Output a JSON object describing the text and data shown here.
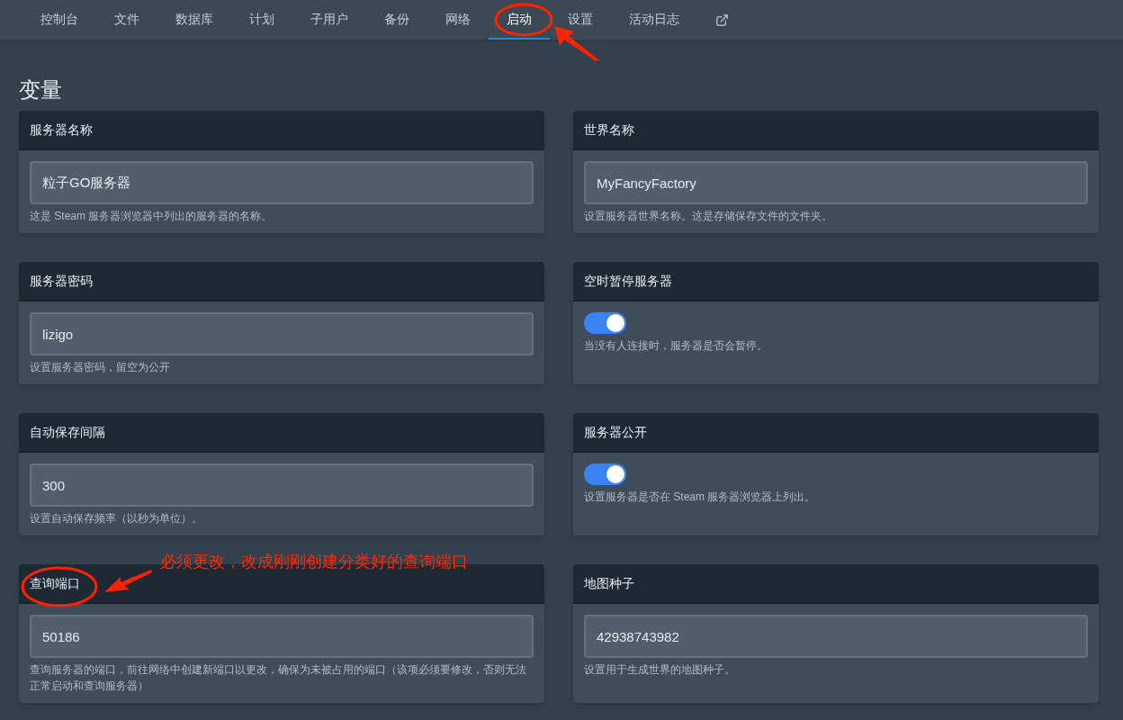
{
  "nav": {
    "tabs": [
      {
        "label": "控制台",
        "selected": false
      },
      {
        "label": "文件",
        "selected": false
      },
      {
        "label": "数据库",
        "selected": false
      },
      {
        "label": "计划",
        "selected": false
      },
      {
        "label": "子用户",
        "selected": false
      },
      {
        "label": "备份",
        "selected": false
      },
      {
        "label": "网络",
        "selected": false
      },
      {
        "label": "启动",
        "selected": true
      },
      {
        "label": "设置",
        "selected": false
      },
      {
        "label": "活动日志",
        "selected": false
      }
    ]
  },
  "heading": "变量",
  "variables": [
    {
      "kind": "text",
      "title": "服务器名称",
      "value": "粒子GO服务器",
      "hint": "这是 Steam 服务器浏览器中列出的服务器的名称。"
    },
    {
      "kind": "text",
      "title": "世界名称",
      "value": "MyFancyFactory",
      "hint": "设置服务器世界名称。这是存储保存文件的文件夹。"
    },
    {
      "kind": "text",
      "title": "服务器密码",
      "value": "lizigo",
      "hint": "设置服务器密码，留空为公开"
    },
    {
      "kind": "toggle",
      "title": "空时暂停服务器",
      "on": true,
      "hint": "当没有人连接时，服务器是否会暂停。"
    },
    {
      "kind": "text",
      "title": "自动保存间隔",
      "value": "300",
      "hint": "设置自动保存频率（以秒为单位）。"
    },
    {
      "kind": "toggle",
      "title": "服务器公开",
      "on": true,
      "hint": "设置服务器是否在 Steam 服务器浏览器上列出。"
    },
    {
      "kind": "text",
      "title": "查询端口",
      "value": "50186",
      "hint": "查询服务器的端口，前往网络中创建新端口以更改，确保为未被占用的端口（该项必须要修改，否则无法正常启动和查询服务器）"
    },
    {
      "kind": "text",
      "title": "地图种子",
      "value": "42938743982",
      "hint": "设置用于生成世界的地图种子。"
    }
  ],
  "annotation": {
    "text": "必须更改，改成刚刚创建分类好的查询端口"
  }
}
